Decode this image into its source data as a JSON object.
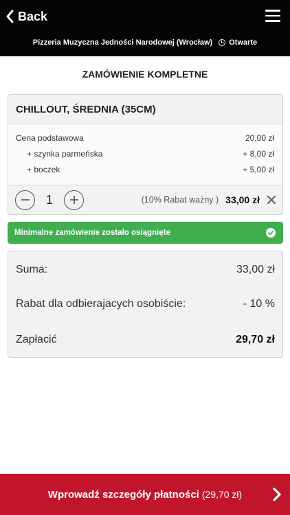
{
  "header": {
    "back_label": "Back",
    "store_name": "Pizzeria Muzyczna Jedności Narodowej (Wrocław)",
    "store_status": "Otwarte"
  },
  "page_title": "ZAMÓWIENIE KOMPLETNE",
  "order_item": {
    "name": "CHILLOUT, ŚREDNIA (35CM)",
    "base_label": "Cena podstawowa",
    "base_price": "20,00 zł",
    "addons": [
      {
        "label": "+ szynka parmeńska",
        "price": "+ 8,00 zł"
      },
      {
        "label": "+ boczek",
        "price": "+ 5,00 zł"
      }
    ],
    "quantity": "1",
    "discount_note": "(10% Rabat ważny )",
    "line_total": "33,00 zł"
  },
  "min_order_message": "Minimalne zamówienie zostało osiągnięte",
  "summary": {
    "subtotal_label": "Suma:",
    "subtotal_value": "33,00 zł",
    "discount_label": "Rabat dla odbierajacych osobiście:",
    "discount_value": "- 10 %",
    "pay_label": "Zapłacić",
    "pay_value": "29,70 zł"
  },
  "checkout": {
    "label": "Wprowadź szczegóły płatności",
    "amount": "(29,70 zł)"
  },
  "colors": {
    "header_bg": "#050505",
    "success_green": "#3fae4f",
    "checkout_red": "#c0152b"
  },
  "icons": {
    "back": "chevron-left-icon",
    "menu": "hamburger-menu-icon",
    "clock": "clock-icon",
    "minus": "minus-circle-icon",
    "plus": "plus-circle-icon",
    "remove": "close-icon",
    "check": "check-circle-icon",
    "forward": "chevron-right-icon"
  }
}
